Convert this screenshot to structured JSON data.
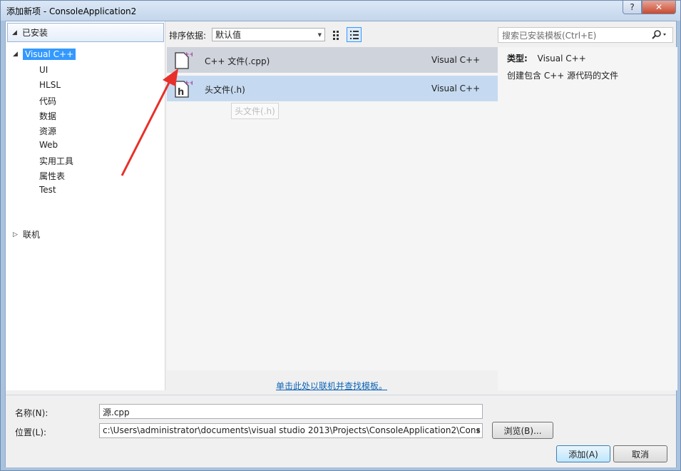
{
  "window": {
    "title": "添加新项 - ConsoleApplication2",
    "help_label": "?",
    "close_label": "✕"
  },
  "left": {
    "installed_label": "已安装",
    "root_label": "Visual C++",
    "children": [
      "UI",
      "HLSL",
      "代码",
      "数据",
      "资源",
      "Web",
      "实用工具",
      "属性表",
      "Test"
    ],
    "online_label": "联机"
  },
  "toolbar": {
    "sort_label": "排序依据:",
    "sort_value": "默认值",
    "search_placeholder": "搜索已安装模板(Ctrl+E)"
  },
  "templates": [
    {
      "name": "C++ 文件(.cpp)",
      "type": "Visual C++"
    },
    {
      "name": "头文件(.h)",
      "type": "Visual C++"
    }
  ],
  "tooltip": "头文件(.h)",
  "details": {
    "type_key": "类型:",
    "type_value": "Visual C++",
    "description": "创建包含 C++ 源代码的文件"
  },
  "online_link": "单击此处以联机并查找模板。",
  "form": {
    "name_label": "名称(N):",
    "name_value": "源.cpp",
    "location_label": "位置(L):",
    "location_value": "c:\\Users\\administrator\\documents\\visual studio 2013\\Projects\\ConsoleApplication2\\Cons",
    "browse_label": "浏览(B)...",
    "add_label": "添加(A)",
    "cancel_label": "取消"
  },
  "colors": {
    "selected_blue": "#3399ff",
    "annotation_red": "#e8302a",
    "link_blue": "#0b63b6"
  }
}
